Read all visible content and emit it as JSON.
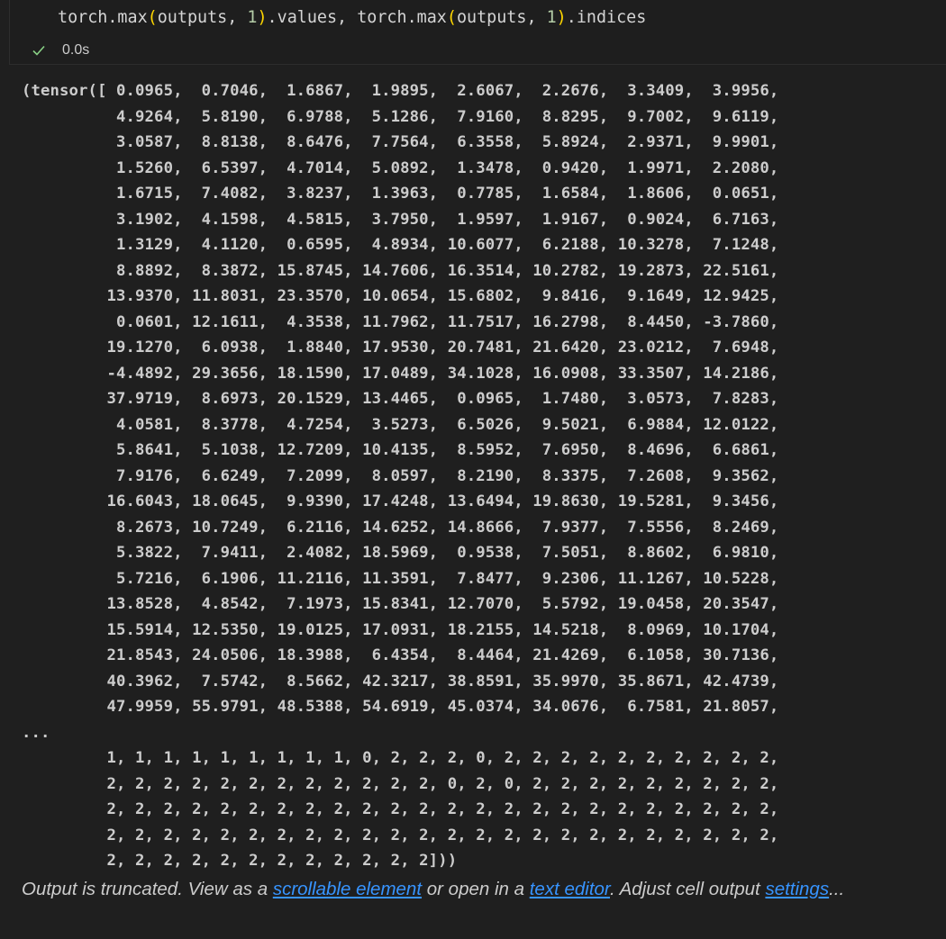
{
  "cell": {
    "code": {
      "fn1": "torch.max",
      "open1": "(",
      "arg1": "outputs, ",
      "dim1": "1",
      "close1": ")",
      "attr1": ".values, ",
      "fn2": "torch.max",
      "open2": "(",
      "arg2": "outputs, ",
      "dim2": "1",
      "close2": ")",
      "attr2": ".indices"
    },
    "status": {
      "icon": "check-icon",
      "time": "0.0s",
      "color": "#89d185"
    }
  },
  "output": {
    "text": "(tensor([ 0.0965,  0.7046,  1.6867,  1.9895,  2.6067,  2.2676,  3.3409,  3.9956,\n          4.9264,  5.8190,  6.9788,  5.1286,  7.9160,  8.8295,  9.7002,  9.6119,\n          3.0587,  8.8138,  8.6476,  7.7564,  6.3558,  5.8924,  2.9371,  9.9901,\n          1.5260,  6.5397,  4.7014,  5.0892,  1.3478,  0.9420,  1.9971,  2.2080,\n          1.6715,  7.4082,  3.8237,  1.3963,  0.7785,  1.6584,  1.8606,  0.0651,\n          3.1902,  4.1598,  4.5815,  3.7950,  1.9597,  1.9167,  0.9024,  6.7163,\n          1.3129,  4.1120,  0.6595,  4.8934, 10.6077,  6.2188, 10.3278,  7.1248,\n          8.8892,  8.3872, 15.8745, 14.7606, 16.3514, 10.2782, 19.2873, 22.5161,\n         13.9370, 11.8031, 23.3570, 10.0654, 15.6802,  9.8416,  9.1649, 12.9425,\n          0.0601, 12.1611,  4.3538, 11.7962, 11.7517, 16.2798,  8.4450, -3.7860,\n         19.1270,  6.0938,  1.8840, 17.9530, 20.7481, 21.6420, 23.0212,  7.6948,\n         -4.4892, 29.3656, 18.1590, 17.0489, 34.1028, 16.0908, 33.3507, 14.2186,\n         37.9719,  8.6973, 20.1529, 13.4465,  0.0965,  1.7480,  3.0573,  7.8283,\n          4.0581,  8.3778,  4.7254,  3.5273,  6.5026,  9.5021,  6.9884, 12.0122,\n          5.8641,  5.1038, 12.7209, 10.4135,  8.5952,  7.6950,  8.4696,  6.6861,\n          7.9176,  6.6249,  7.2099,  8.0597,  8.2190,  8.3375,  7.2608,  9.3562,\n         16.6043, 18.0645,  9.9390, 17.4248, 13.6494, 19.8630, 19.5281,  9.3456,\n          8.2673, 10.7249,  6.2116, 14.6252, 14.8666,  7.9377,  7.5556,  8.2469,\n          5.3822,  7.9411,  2.4082, 18.5969,  0.9538,  7.5051,  8.8602,  6.9810,\n          5.7216,  6.1906, 11.2116, 11.3591,  7.8477,  9.2306, 11.1267, 10.5228,\n         13.8528,  4.8542,  7.1973, 15.8341, 12.7070,  5.5792, 19.0458, 20.3547,\n         15.5914, 12.5350, 19.0125, 17.0931, 18.2155, 14.5218,  8.0969, 10.1704,\n         21.8543, 24.0506, 18.3988,  6.4354,  8.4464, 21.4269,  6.1058, 30.7136,\n         40.3962,  7.5742,  8.5662, 42.3217, 38.8591, 35.9970, 35.8671, 42.4739,\n         47.9959, 55.9791, 48.5388, 54.6919, 45.0374, 34.0676,  6.7581, 21.8057,\n...\n         1, 1, 1, 1, 1, 1, 1, 1, 1, 0, 2, 2, 2, 0, 2, 2, 2, 2, 2, 2, 2, 2, 2, 2,\n         2, 2, 2, 2, 2, 2, 2, 2, 2, 2, 2, 2, 0, 2, 0, 2, 2, 2, 2, 2, 2, 2, 2, 2,\n         2, 2, 2, 2, 2, 2, 2, 2, 2, 2, 2, 2, 2, 2, 2, 2, 2, 2, 2, 2, 2, 2, 2, 2,\n         2, 2, 2, 2, 2, 2, 2, 2, 2, 2, 2, 2, 2, 2, 2, 2, 2, 2, 2, 2, 2, 2, 2, 2,\n         2, 2, 2, 2, 2, 2, 2, 2, 2, 2, 2, 2]))"
  },
  "truncation": {
    "prefix": "Output is truncated. View as a ",
    "link1": "scrollable element",
    "middle": " or open in a ",
    "link2": "text editor",
    "suffix": ". Adjust cell output ",
    "link3": "settings",
    "ellipsis": "..."
  }
}
